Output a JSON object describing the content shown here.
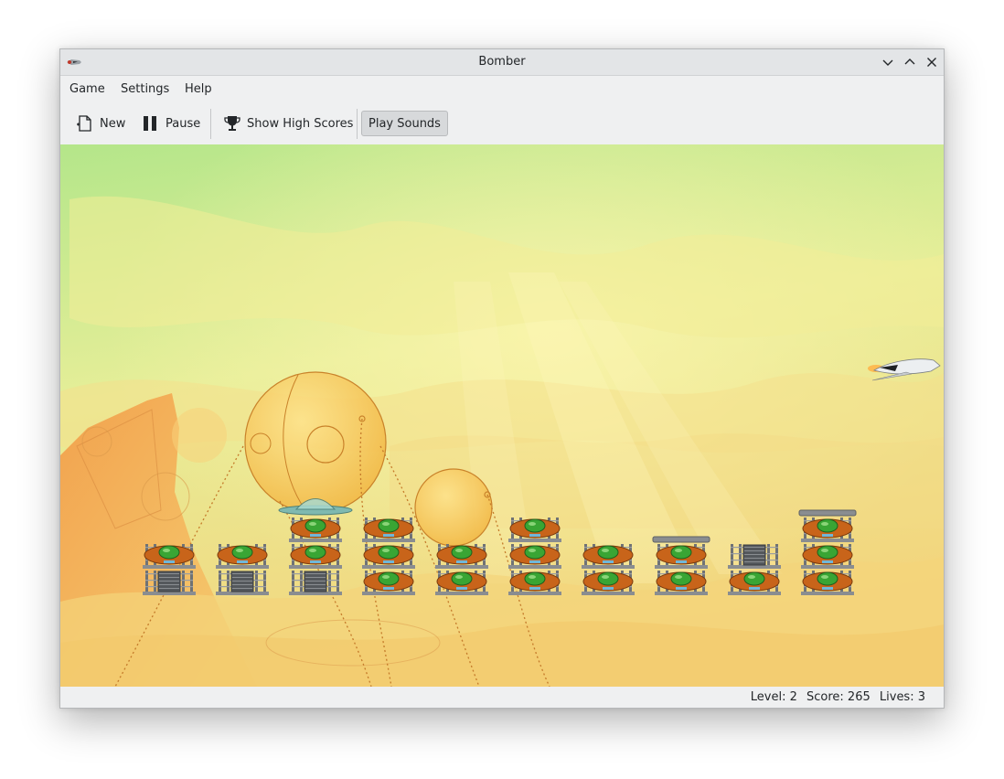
{
  "window": {
    "title": "Bomber"
  },
  "menu": [
    {
      "label": "Game"
    },
    {
      "label": "Settings"
    },
    {
      "label": "Help"
    }
  ],
  "toolbar": {
    "new_label": "New",
    "pause_label": "Pause",
    "highscores_label": "Show High Scores",
    "sounds_label": "Play Sounds",
    "sounds_active": true
  },
  "icons": {
    "new": "document-new-icon",
    "pause": "pause-icon",
    "highscores": "trophy-icon",
    "minimize": "chevron-down-icon",
    "maximize": "chevron-up-icon",
    "close": "close-icon"
  },
  "game": {
    "towers": [
      {
        "floors": [
          "glass",
          "pod"
        ]
      },
      {
        "floors": [
          "glass",
          "pod"
        ]
      },
      {
        "floors": [
          "glass",
          "pod",
          "pod"
        ],
        "roof": "dome"
      },
      {
        "floors": [
          "pod",
          "pod",
          "pod"
        ]
      },
      {
        "floors": [
          "pod",
          "pod"
        ]
      },
      {
        "floors": [
          "pod",
          "pod",
          "pod"
        ]
      },
      {
        "floors": [
          "pod",
          "pod"
        ]
      },
      {
        "floors": [
          "pod",
          "pod"
        ],
        "roof": "slab"
      },
      {
        "floors": [
          "pod",
          "glass"
        ]
      },
      {
        "floors": [
          "pod",
          "pod",
          "pod"
        ],
        "roof": "slab"
      }
    ],
    "colors": {
      "sky_top": "#b8e88c",
      "sky_mid": "#e8ef9a",
      "ground": "#f2d27a",
      "pod_shell": "#c8641a",
      "pod_window": "#39a534",
      "frame": "#6f7275"
    }
  },
  "status": {
    "level": "Level: 2",
    "score": "Score: 265",
    "lives": "Lives: 3"
  }
}
